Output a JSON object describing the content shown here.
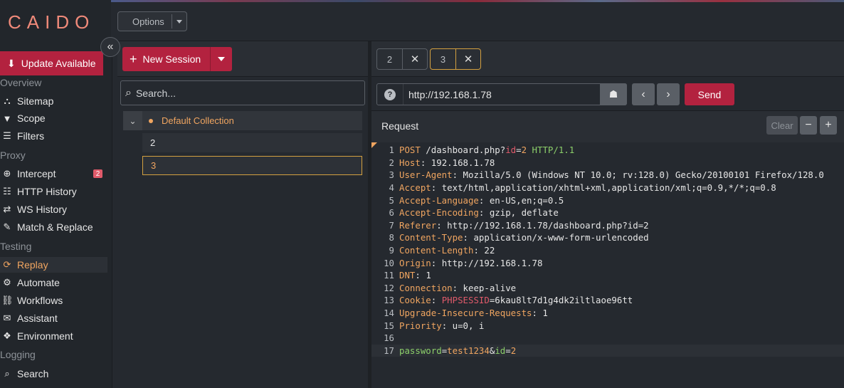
{
  "app": {
    "logo": "CAIDO",
    "options_label": "Options"
  },
  "sidebar": {
    "update_label": "Update Available",
    "sections": {
      "overview": "Overview",
      "proxy": "Proxy",
      "testing": "Testing",
      "logging": "Logging"
    },
    "items": {
      "sitemap": "Sitemap",
      "scope": "Scope",
      "filters": "Filters",
      "intercept": "Intercept",
      "intercept_badge": "2",
      "http_history": "HTTP History",
      "ws_history": "WS History",
      "match_replace": "Match & Replace",
      "replay": "Replay",
      "automate": "Automate",
      "workflows": "Workflows",
      "assistant": "Assistant",
      "environment": "Environment",
      "search": "Search"
    }
  },
  "sessions": {
    "new_session_label": "New Session",
    "search_placeholder": "Search...",
    "collection_name": "Default Collection",
    "items": [
      "2",
      "3"
    ]
  },
  "replay": {
    "tabs": [
      "2",
      "3"
    ],
    "url": "http://192.168.1.78",
    "send_label": "Send",
    "request_title": "Request",
    "clear_label": "Clear",
    "lines": {
      "l1": {
        "n": "1",
        "method": "POST",
        "path": " /dashboard.php?",
        "qk": "id",
        "eq": "=",
        "qv": "2",
        "ver": " HTTP/1.1"
      },
      "l2": {
        "n": "2",
        "k": "Host",
        "v": " 192.168.1.78"
      },
      "l3": {
        "n": "3",
        "k": "User-Agent",
        "v": " Mozilla/5.0 (Windows NT 10.0; rv:128.0) Gecko/20100101 Firefox/128.0"
      },
      "l4": {
        "n": "4",
        "k": "Accept",
        "v": " text/html,application/xhtml+xml,application/xml;q=0.9,*/*;q=0.8"
      },
      "l5": {
        "n": "5",
        "k": "Accept-Language",
        "v": " en-US,en;q=0.5"
      },
      "l6": {
        "n": "6",
        "k": "Accept-Encoding",
        "v": " gzip, deflate"
      },
      "l7": {
        "n": "7",
        "k": "Referer",
        "v": " http://192.168.1.78/dashboard.php?id=2"
      },
      "l8": {
        "n": "8",
        "k": "Content-Type",
        "v": " application/x-www-form-urlencoded"
      },
      "l9": {
        "n": "9",
        "k": "Content-Length",
        "v": " 22"
      },
      "l10": {
        "n": "10",
        "k": "Origin",
        "v": " http://192.168.1.78"
      },
      "l11": {
        "n": "11",
        "k": "DNT",
        "v": " 1"
      },
      "l12": {
        "n": "12",
        "k": "Connection",
        "v": " keep-alive"
      },
      "l13": {
        "n": "13",
        "k": "Cookie",
        "ck": "PHPSESSID",
        "cv": "6kau8lt7d1g4dk2iltlaoe96tt"
      },
      "l14": {
        "n": "14",
        "k": "Upgrade-Insecure-Requests",
        "v": " 1"
      },
      "l15": {
        "n": "15",
        "k": "Priority",
        "v": " u=0, i"
      },
      "l16": {
        "n": "16"
      },
      "l17": {
        "n": "17",
        "k1": "password",
        "v1": "test1234",
        "amp": "&",
        "k2": "id",
        "v2": "2"
      }
    }
  }
}
